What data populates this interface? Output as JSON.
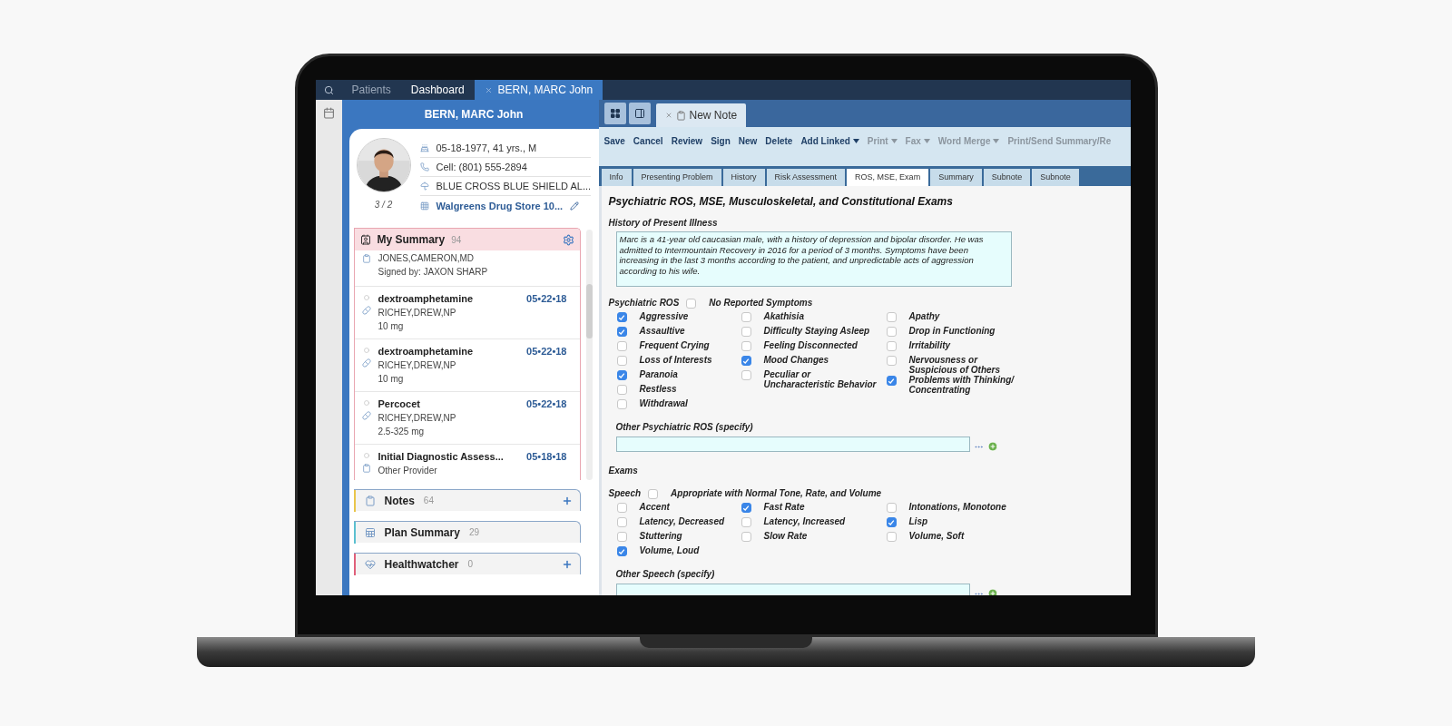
{
  "top_tabs": [
    {
      "label": "Patients",
      "muted": true,
      "closable": false,
      "selected": false
    },
    {
      "label": "Dashboard",
      "muted": false,
      "closable": false,
      "selected": false
    },
    {
      "label": "BERN, MARC John",
      "muted": false,
      "closable": true,
      "selected": true
    }
  ],
  "patient": {
    "name": "BERN, MARC John",
    "birth": "05-18-1977, 41 yrs., M",
    "phone": "Cell: (801) 555-2894",
    "insurance": "BLUE CROSS BLUE SHIELD AL...",
    "pharmacy": "Walgreens Drug Store 10...",
    "photo_count": "3 / 2"
  },
  "summary": {
    "title": "My Summary",
    "count": "94",
    "entries": [
      {
        "kind": "note",
        "provider": "JONES,CAMERON,MD",
        "detail": "Signed by: JAXON SHARP"
      },
      {
        "kind": "medication",
        "title": "dextroamphetamine",
        "date": "05•22•18",
        "provider": "RICHEY,DREW,NP",
        "detail": "10 mg"
      },
      {
        "kind": "medication",
        "title": "dextroamphetamine",
        "date": "05•22•18",
        "provider": "RICHEY,DREW,NP",
        "detail": "10 mg"
      },
      {
        "kind": "medication",
        "title": "Percocet",
        "date": "05•22•18",
        "provider": "RICHEY,DREW,NP",
        "detail": "2.5-325 mg"
      },
      {
        "kind": "note",
        "title": "Initial Diagnostic Assess...",
        "date": "05•18•18",
        "provider": "Other Provider"
      }
    ]
  },
  "sections": [
    {
      "kind": "notes",
      "title": "Notes",
      "count": "64",
      "addable": true,
      "color": "#e9c54a"
    },
    {
      "kind": "plan",
      "title": "Plan Summary",
      "count": "29",
      "addable": false,
      "color": "#5bc0d0"
    },
    {
      "kind": "health",
      "title": "Healthwatcher",
      "count": "0",
      "addable": true,
      "color": "#e0607a"
    }
  ],
  "note_tab": {
    "label": "New Note"
  },
  "toolbar": [
    {
      "label": "Save",
      "disabled": false,
      "dropdown": false
    },
    {
      "label": "Cancel",
      "disabled": false,
      "dropdown": false
    },
    {
      "label": "Review",
      "disabled": false,
      "dropdown": false
    },
    {
      "label": "Sign",
      "disabled": false,
      "dropdown": false
    },
    {
      "label": "New",
      "disabled": false,
      "dropdown": false
    },
    {
      "label": "Delete",
      "disabled": false,
      "dropdown": false
    },
    {
      "label": "Add Linked",
      "disabled": false,
      "dropdown": true
    },
    {
      "label": "Print",
      "disabled": true,
      "dropdown": true
    },
    {
      "label": "Fax",
      "disabled": true,
      "dropdown": true
    },
    {
      "label": "Word Merge",
      "disabled": true,
      "dropdown": true
    },
    {
      "label": "Print/Send Summary/Re",
      "disabled": true,
      "dropdown": false
    }
  ],
  "form_tabs": [
    {
      "label": "Info",
      "selected": false
    },
    {
      "label": "Presenting Problem",
      "selected": false
    },
    {
      "label": "History",
      "selected": false
    },
    {
      "label": "Risk Assessment",
      "selected": false
    },
    {
      "label": "ROS, MSE, Exam",
      "selected": true
    },
    {
      "label": "Summary",
      "selected": false
    },
    {
      "label": "Subnote",
      "selected": false
    },
    {
      "label": "Subnote",
      "selected": false
    }
  ],
  "form": {
    "title": "Psychiatric ROS, MSE, Musculoskeletal, and Constitutional Exams",
    "hpi_label": "History of Present Illness",
    "hpi_text": "Marc is a 41-year old caucasian male, with a history of depression and bipolar disorder. He was admitted to Intermountain Recovery in 2016 for a period of 3 months. Symptoms have been increasing in the last 3 months according to the patient, and unpredictable acts of aggression according to his wife.",
    "ros": {
      "label": "Psychiatric ROS",
      "none_label": "No Reported Symptoms",
      "none_checked": false,
      "columns": [
        [
          {
            "label": "Aggressive",
            "checked": true
          },
          {
            "label": "Assaultive",
            "checked": true
          },
          {
            "label": "Frequent Crying",
            "checked": false
          },
          {
            "label": "Loss of Interests",
            "checked": false
          },
          {
            "label": "Paranoia",
            "checked": true
          },
          {
            "label": "Restless",
            "checked": false
          },
          {
            "label": "Withdrawal",
            "checked": false
          }
        ],
        [
          {
            "label": "Akathisia",
            "checked": false
          },
          {
            "label": "Difficulty Staying Asleep",
            "checked": false
          },
          {
            "label": "Feeling Disconnected",
            "checked": false
          },
          {
            "label": "Mood Changes",
            "checked": true
          },
          {
            "label": "Peculiar or Uncharacteristic Behavior",
            "checked": false
          }
        ],
        [
          {
            "label": "Apathy",
            "checked": false
          },
          {
            "label": "Drop in Functioning",
            "checked": false
          },
          {
            "label": "Irritability",
            "checked": false
          },
          {
            "label": "Nervousness or Suspicious of Others",
            "checked": false
          },
          {
            "label": "Problems with Thinking/ Concentrating",
            "checked": true
          }
        ]
      ],
      "other_label": "Other Psychiatric ROS (specify)"
    },
    "exams_label": "Exams",
    "speech": {
      "label": "Speech",
      "none_label": "Appropriate with Normal Tone, Rate, and Volume",
      "none_checked": false,
      "columns": [
        [
          {
            "label": "Accent",
            "checked": false
          },
          {
            "label": "Latency, Decreased",
            "checked": false
          },
          {
            "label": "Stuttering",
            "checked": false
          },
          {
            "label": "Volume, Loud",
            "checked": true
          }
        ],
        [
          {
            "label": "Fast Rate",
            "checked": true
          },
          {
            "label": "Latency, Increased",
            "checked": false
          },
          {
            "label": "Slow Rate",
            "checked": false
          }
        ],
        [
          {
            "label": "Intonations, Monotone",
            "checked": false
          },
          {
            "label": "Lisp",
            "checked": true
          },
          {
            "label": "Volume, Soft",
            "checked": false
          }
        ]
      ],
      "other_label": "Other Speech (specify)"
    }
  }
}
